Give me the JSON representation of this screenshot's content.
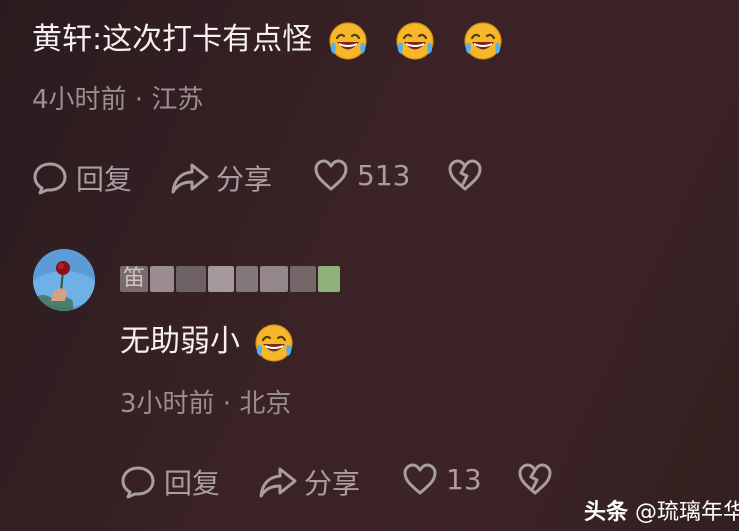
{
  "comment1": {
    "text": "黄轩:这次打卡有点怪",
    "emoji_name": "rolling-laughing-emoji",
    "emoji_count": 3,
    "meta": "4小时前 · 江苏",
    "actions": {
      "reply": "回复",
      "share": "分享",
      "likes": "513"
    }
  },
  "comment2": {
    "author_blurred_prefix": "笛",
    "text": "无助弱小",
    "emoji_name": "rolling-laughing-emoji",
    "meta": "3小时前 · 北京",
    "actions": {
      "reply": "回复",
      "share": "分享",
      "likes": "13"
    }
  },
  "watermark": {
    "brand": "头条",
    "handle": "@琉璃年华"
  },
  "colors": {
    "accent_text": "#f6f0f0",
    "muted": "#a89da0",
    "emoji_yellow": "#f6b82a"
  }
}
